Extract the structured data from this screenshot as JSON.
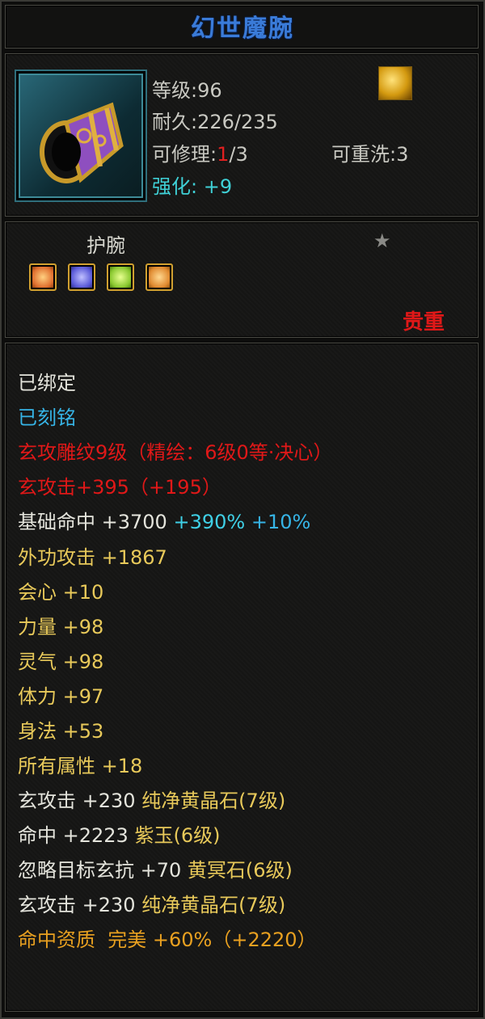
{
  "title": "幻世魔腕",
  "item": {
    "icon": "bracer-item-icon",
    "level_label": "等级:96",
    "durability_label": "耐久:226/235",
    "repair_prefix": "可修理:",
    "repair_current": "1",
    "repair_suffix": "/3",
    "rewash_label": "可重洗:3",
    "enhance_label": "强化: +9",
    "feature_icon": "gold-sparkle-icon"
  },
  "slot": {
    "label": "护腕",
    "star_icon": "star-icon",
    "gems": [
      {
        "name": "gem-orange",
        "color": "#e07030"
      },
      {
        "name": "gem-purple",
        "color": "#5a5ad8"
      },
      {
        "name": "gem-green",
        "color": "#8ac830"
      },
      {
        "name": "gem-orange-2",
        "color": "#e08a30"
      }
    ],
    "rarity": "贵重"
  },
  "properties": {
    "bound": "已绑定",
    "engraved": "已刻铭",
    "carve": "玄攻雕纹9级（精绘：6级0等·决心）",
    "xuan_attack": "玄攻击+395（+195）",
    "base_hit_name": "基础命中",
    "base_hit_value": "+3700",
    "base_hit_pct1": "+390%",
    "base_hit_pct2": "+10%",
    "ext_atk_name": "外功攻击",
    "ext_atk_value": "+1867",
    "crit_name": "会心",
    "crit_value": "+10",
    "str_name": "力量",
    "str_value": "+98",
    "spirit_name": "灵气",
    "spirit_value": "+98",
    "vit_name": "体力",
    "vit_value": "+97",
    "agi_name": "身法",
    "agi_value": "+53",
    "all_name": "所有属性",
    "all_value": "+18",
    "gem1_stat": "玄攻击 +230",
    "gem1_name": "纯净黄晶石(7级)",
    "gem2_stat": "命中 +2223",
    "gem2_name": "紫玉(6级)",
    "gem3_stat": "忽略目标玄抗 +70",
    "gem3_name": "黄冥石(6级)",
    "gem4_stat": "玄攻击 +230",
    "gem4_name": "纯净黄晶石(7级)",
    "quality_name": "命中资质",
    "quality_grade": "完美",
    "quality_value": "+60%（+2220）"
  }
}
